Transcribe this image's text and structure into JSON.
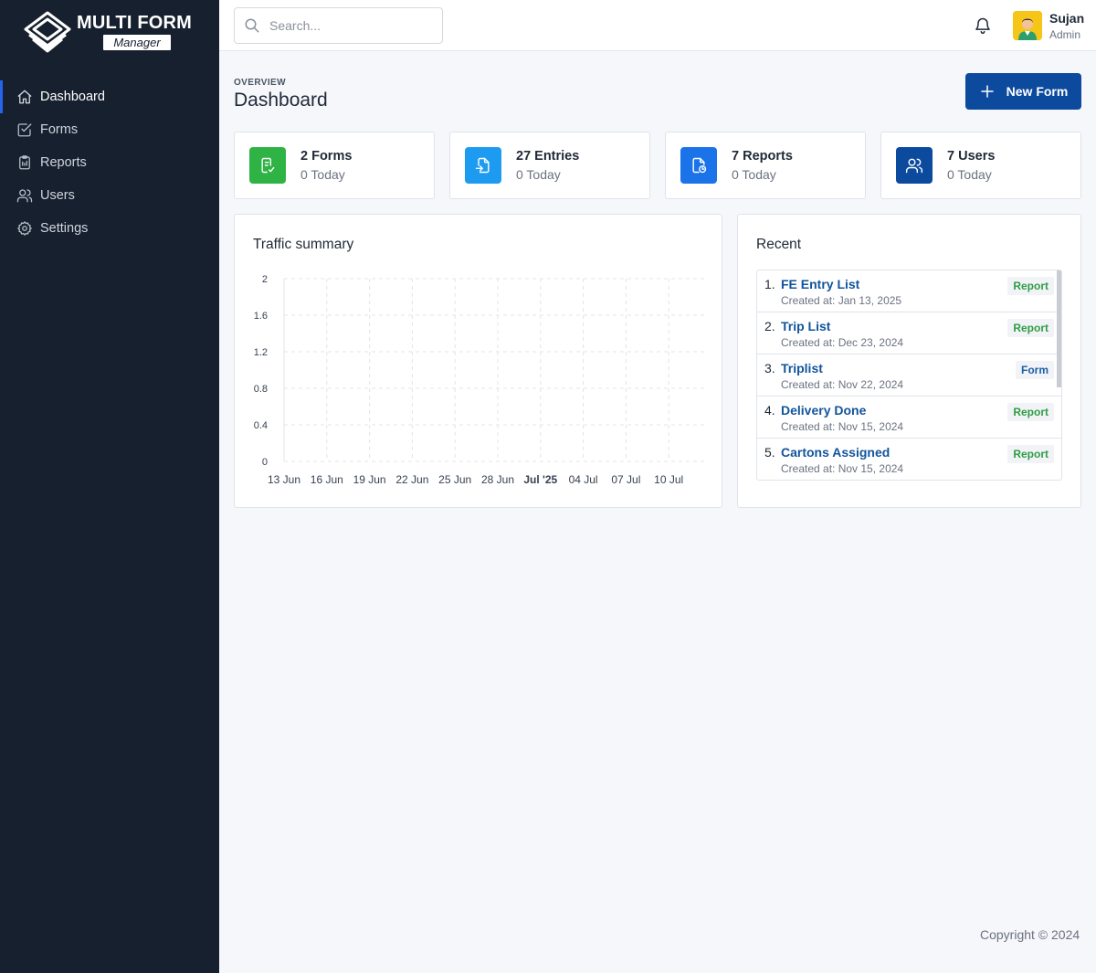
{
  "brand": {
    "title": "MULTI FORM",
    "subtitle": "Manager"
  },
  "sidebar": {
    "items": [
      {
        "label": "Dashboard",
        "icon": "home-icon",
        "active": true
      },
      {
        "label": "Forms",
        "icon": "check-square-icon"
      },
      {
        "label": "Reports",
        "icon": "clipboard-icon"
      },
      {
        "label": "Users",
        "icon": "users-icon"
      },
      {
        "label": "Settings",
        "icon": "gear-icon"
      }
    ]
  },
  "header": {
    "search_placeholder": "Search...",
    "user": {
      "name": "Sujan",
      "role": "Admin"
    }
  },
  "page": {
    "overline": "OVERVIEW",
    "title": "Dashboard",
    "new_button": "New Form"
  },
  "stats": [
    {
      "title": "2 Forms",
      "sub": "0 Today",
      "icon": "form-icon",
      "color": "#2fb344"
    },
    {
      "title": "27 Entries",
      "sub": "0 Today",
      "icon": "file-import-icon",
      "color": "#1d9bf0"
    },
    {
      "title": "7 Reports",
      "sub": "0 Today",
      "icon": "report-icon",
      "color": "#1a73e8"
    },
    {
      "title": "7 Users",
      "sub": "0 Today",
      "icon": "users-icon",
      "color": "#0c4a9e"
    }
  ],
  "traffic": {
    "title": "Traffic summary",
    "chart_data": {
      "type": "line",
      "title": "",
      "xlabel": "",
      "ylabel": "",
      "x": [
        "13 Jun",
        "16 Jun",
        "19 Jun",
        "22 Jun",
        "25 Jun",
        "28 Jun",
        "Jul '25",
        "04 Jul",
        "07 Jul",
        "10 Jul"
      ],
      "y_ticks": [
        "2",
        "1.6",
        "1.2",
        "0.8",
        "0.4",
        "0"
      ],
      "ylim": [
        0,
        2
      ],
      "grid": true,
      "series": []
    }
  },
  "recent": {
    "title": "Recent",
    "items": [
      {
        "num": "1.",
        "name": "FE Entry List",
        "date": "Created at: Jan 13, 2025",
        "badge": "Report"
      },
      {
        "num": "2.",
        "name": "Trip List",
        "date": "Created at: Dec 23, 2024",
        "badge": "Report"
      },
      {
        "num": "3.",
        "name": "Triplist",
        "date": "Created at: Nov 22, 2024",
        "badge": "Form"
      },
      {
        "num": "4.",
        "name": "Delivery Done",
        "date": "Created at: Nov 15, 2024",
        "badge": "Report"
      },
      {
        "num": "5.",
        "name": "Cartons Assigned",
        "date": "Created at: Nov 15, 2024",
        "badge": "Report"
      }
    ]
  },
  "footer": "Copyright © 2024"
}
